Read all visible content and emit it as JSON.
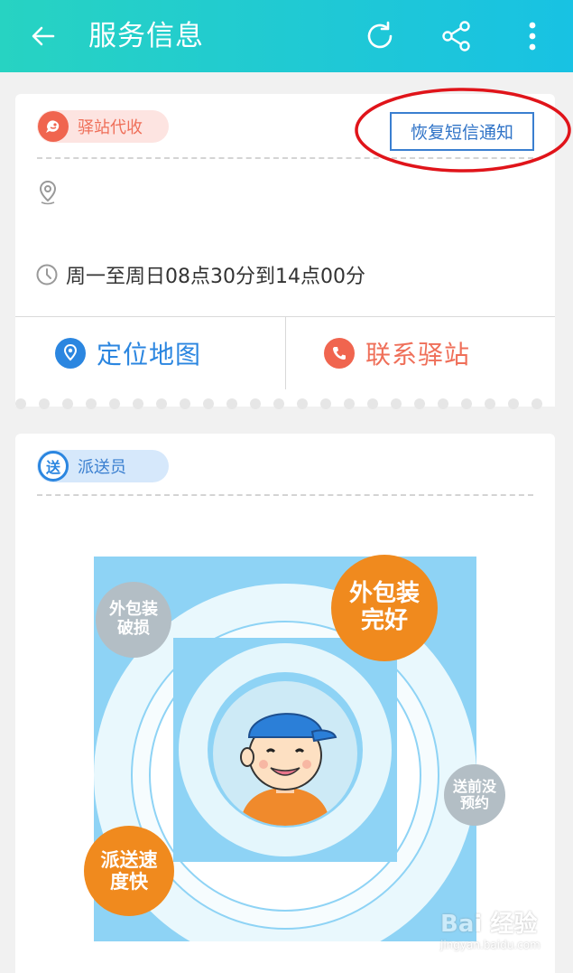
{
  "header": {
    "title": "服务信息",
    "icons": [
      "back-arrow-icon",
      "refresh-icon",
      "share-icon",
      "more-vertical-icon"
    ],
    "background": "#1fc8d6"
  },
  "station_card": {
    "tag_label": "驿站代收",
    "restore_button_label": "恢复短信通知",
    "hours": "周一至周日08点30分到14点00分",
    "actions": {
      "map_label": "定位地图",
      "contact_label": "联系驿站"
    }
  },
  "courier_card": {
    "tag_label": "派送员",
    "tag_icon_text": "送",
    "bubbles": {
      "damaged": "外包装\n破损",
      "intact": "外包装\n完好",
      "no_appointment": "送前没\n预约",
      "fast": "派送速\n度快"
    }
  },
  "watermark": {
    "logo": "Bai 经验",
    "url": "jingyan.baidu.com"
  },
  "colors": {
    "accent_blue": "#2b86e0",
    "accent_red": "#f0654f",
    "bubble_orange": "#f08a1e",
    "bubble_gray": "#b7c2c7",
    "annotation_red": "#e0141a"
  }
}
